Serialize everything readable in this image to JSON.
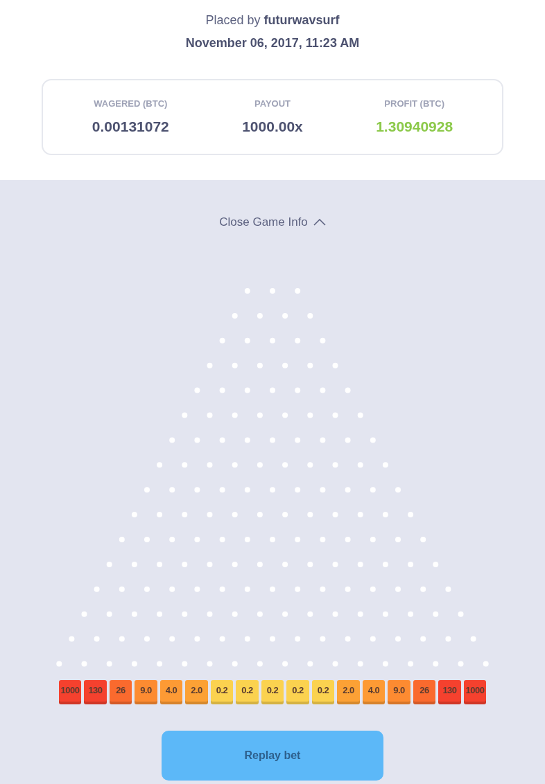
{
  "placed_by": {
    "label": "Placed by",
    "user": "futurwavsurf"
  },
  "date": "November 06, 2017, 11:23 AM",
  "stats": [
    {
      "label": "WAGERED (BTC)",
      "value": "0.00131072",
      "kind": "plain"
    },
    {
      "label": "PAYOUT",
      "value": "1000.00x",
      "kind": "plain"
    },
    {
      "label": "PROFIT (BTC)",
      "value": "1.30940928",
      "kind": "positive"
    }
  ],
  "toggle": {
    "label": "Close Game Info",
    "expanded": true
  },
  "buckets": [
    {
      "label": "1000",
      "color": "#f5412e"
    },
    {
      "label": "130",
      "color": "#f5412e"
    },
    {
      "label": "26",
      "color": "#fa6a2e"
    },
    {
      "label": "9.0",
      "color": "#fd8b31"
    },
    {
      "label": "4.0",
      "color": "#fd9a34"
    },
    {
      "label": "2.0",
      "color": "#fca135"
    },
    {
      "label": "0.2",
      "color": "#fbd24f"
    },
    {
      "label": "0.2",
      "color": "#fbd24f"
    },
    {
      "label": "0.2",
      "color": "#fbd24f"
    },
    {
      "label": "0.2",
      "color": "#fbd24f"
    },
    {
      "label": "0.2",
      "color": "#fbd24f"
    },
    {
      "label": "2.0",
      "color": "#fca135"
    },
    {
      "label": "4.0",
      "color": "#fd9a34"
    },
    {
      "label": "9.0",
      "color": "#fd8b31"
    },
    {
      "label": "26",
      "color": "#fa6a2e"
    },
    {
      "label": "130",
      "color": "#f5412e"
    },
    {
      "label": "1000",
      "color": "#f5412e"
    }
  ],
  "replay_button": "Replay bet"
}
